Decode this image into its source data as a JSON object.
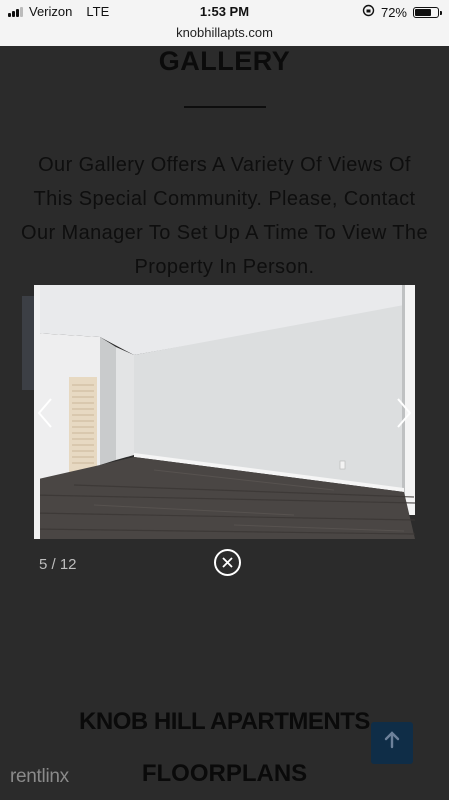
{
  "status_bar": {
    "carrier": "Verizon",
    "network": "LTE",
    "time": "1:53 PM",
    "battery_percent": "72%",
    "battery_level": 0.72
  },
  "browser": {
    "url": "knobhillapts.com"
  },
  "page": {
    "gallery_title": "GALLERY",
    "gallery_description": "Our Gallery Offers A Variety Of Views Of This Special Community. Please, Contact Our Manager To Set Up A Time To View The Property In Person.",
    "section_title": "KNOB HILL APARTMENTS",
    "floorplans_title": "FLOORPLANS",
    "scroll_top_icon": "arrow-up-icon",
    "watermark": "rentlinx"
  },
  "lightbox": {
    "counter": "5 / 12",
    "current": 5,
    "total": 12,
    "prev_icon": "chevron-left-icon",
    "next_icon": "chevron-right-icon",
    "close_icon": "close-icon"
  }
}
